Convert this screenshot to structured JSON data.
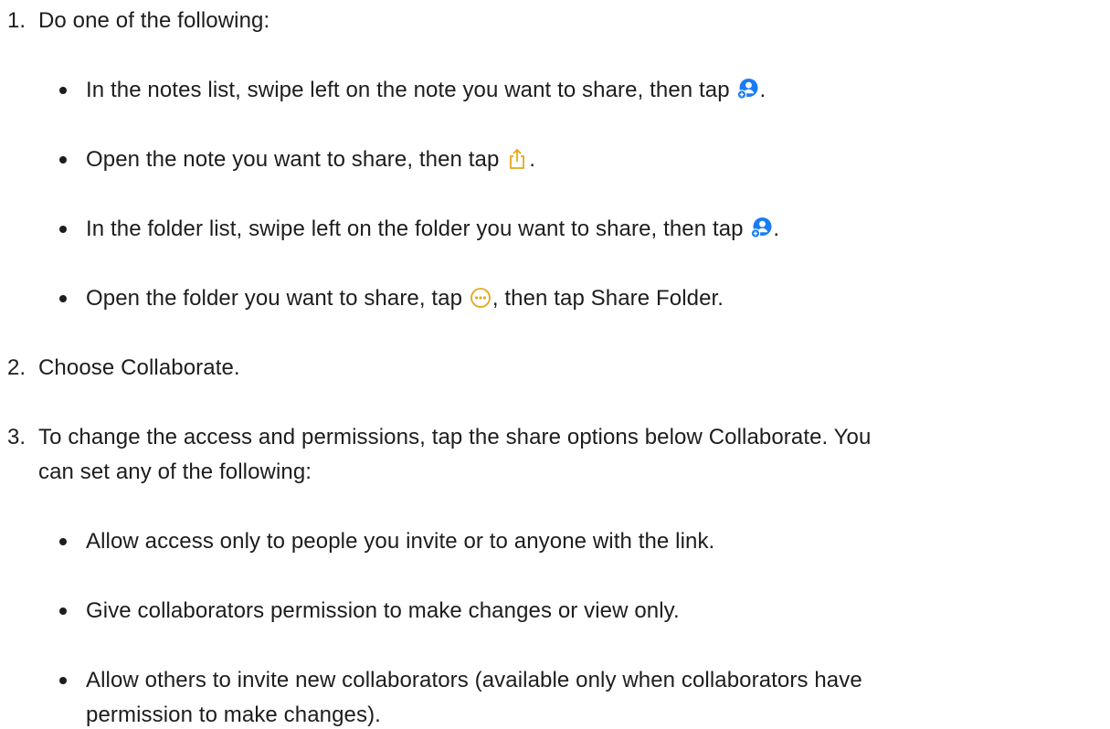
{
  "steps": [
    {
      "number": "1.",
      "text": "Do one of the following:",
      "bullets": [
        {
          "before": "In the notes list, swipe left on the note you want to share, then tap ",
          "icon": "add-person-icon",
          "after": "."
        },
        {
          "before": "Open the note you want to share, then tap ",
          "icon": "share-icon",
          "after": "."
        },
        {
          "before": "In the folder list, swipe left on the folder you want to share, then tap ",
          "icon": "add-person-icon",
          "after": "."
        },
        {
          "before": "Open the folder you want to share, tap ",
          "icon": "more-icon",
          "after": ", then tap Share Folder."
        }
      ]
    },
    {
      "number": "2.",
      "text": "Choose Collaborate."
    },
    {
      "number": "3.",
      "text_line1": "To change the access and permissions, tap the share options below Collaborate. You",
      "text_line2": "can set any of the following:",
      "bullets": [
        {
          "text": "Allow access only to people you invite or to anyone with the link."
        },
        {
          "text": "Give collaborators permission to make changes or view only."
        },
        {
          "text_line1": "Allow others to invite new collaborators (available only when collaborators have",
          "text_line2": "permission to make changes)."
        }
      ]
    }
  ],
  "colors": {
    "text": "#1d1d1f",
    "add_person_icon": "#1a7cf5",
    "share_icon": "#e3a81b",
    "more_icon": "#e3a81b"
  }
}
